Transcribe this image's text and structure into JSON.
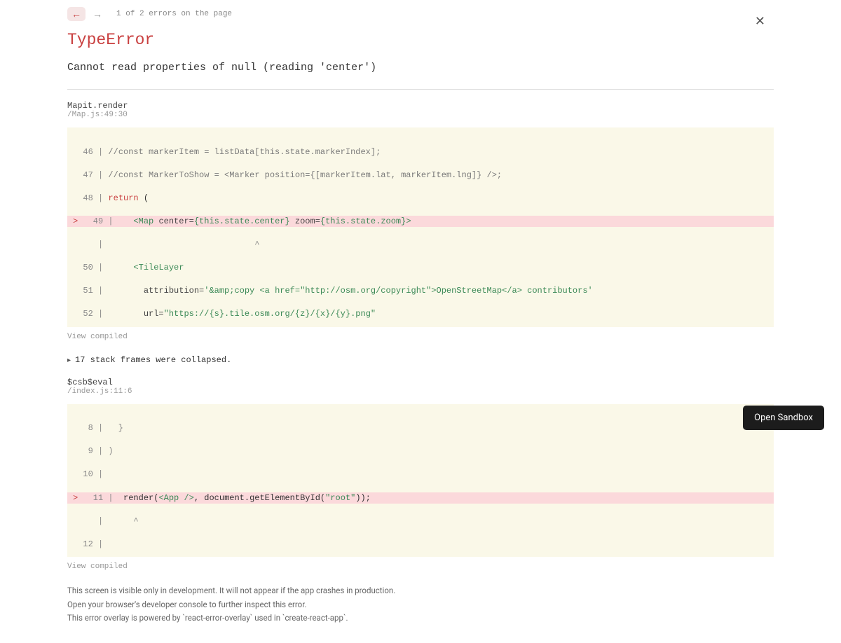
{
  "nav": {
    "counter": "1 of 2 errors on the page"
  },
  "error": {
    "type": "TypeError",
    "message": "Cannot read properties of null (reading 'center')"
  },
  "frame1": {
    "fn": "Mapit.render",
    "loc": "/Map.js:49:30",
    "l46g": "  46 | ",
    "l46c": "//const markerItem = listData[this.state.markerIndex];",
    "l47g": "  47 | ",
    "l47c": "//const MarkerToShow = <Marker position={[markerItem.lat, markerItem.lng]} />;",
    "l48g": "  48 | ",
    "l48k": "return",
    "l48r": " (",
    "l49g": "  49 | ",
    "l49caret": "> ",
    "l49a": "   <",
    "l49t1": "Map",
    "l49b": " center=",
    "l49v1": "{this.state.center}",
    "l49c": " zoom=",
    "l49v2": "{this.state.zoom}",
    "l49d": ">",
    "lptr": "     |                              ^",
    "l50g": "  50 | ",
    "l50a": "     <",
    "l50t": "TileLayer",
    "l51g": "  51 | ",
    "l51a": "       attribution=",
    "l51v": "'&amp;copy <a href=\"http://osm.org/copyright\">OpenStreetMap</a> contributors'",
    "l52g": "  52 | ",
    "l52a": "       url=",
    "l52v": "\"https://{s}.tile.osm.org/{z}/{x}/{y}.png\"",
    "viewCompiled": "View compiled"
  },
  "collapsed": "17 stack frames were collapsed.",
  "frame2": {
    "fn": "$csb$eval",
    "loc": "/index.js:11:6",
    "l8": "   8 |   }",
    "l9": "   9 | )",
    "l10": "  10 | ",
    "l11g": "  11 | ",
    "l11caret": "> ",
    "l11a": " render(",
    "l11t": "<App />",
    "l11b": ", document.getElementById(",
    "l11v": "\"root\"",
    "l11c": "));",
    "lptr": "     |      ^",
    "l12": "  12 | ",
    "viewCompiled": "View compiled"
  },
  "footer": {
    "l1": "This screen is visible only in development. It will not appear if the app crashes in production.",
    "l2": "Open your browser's developer console to further inspect this error.",
    "l3": "This error overlay is powered by `react-error-overlay` used in `create-react-app`."
  },
  "sandbox": "Open Sandbox"
}
